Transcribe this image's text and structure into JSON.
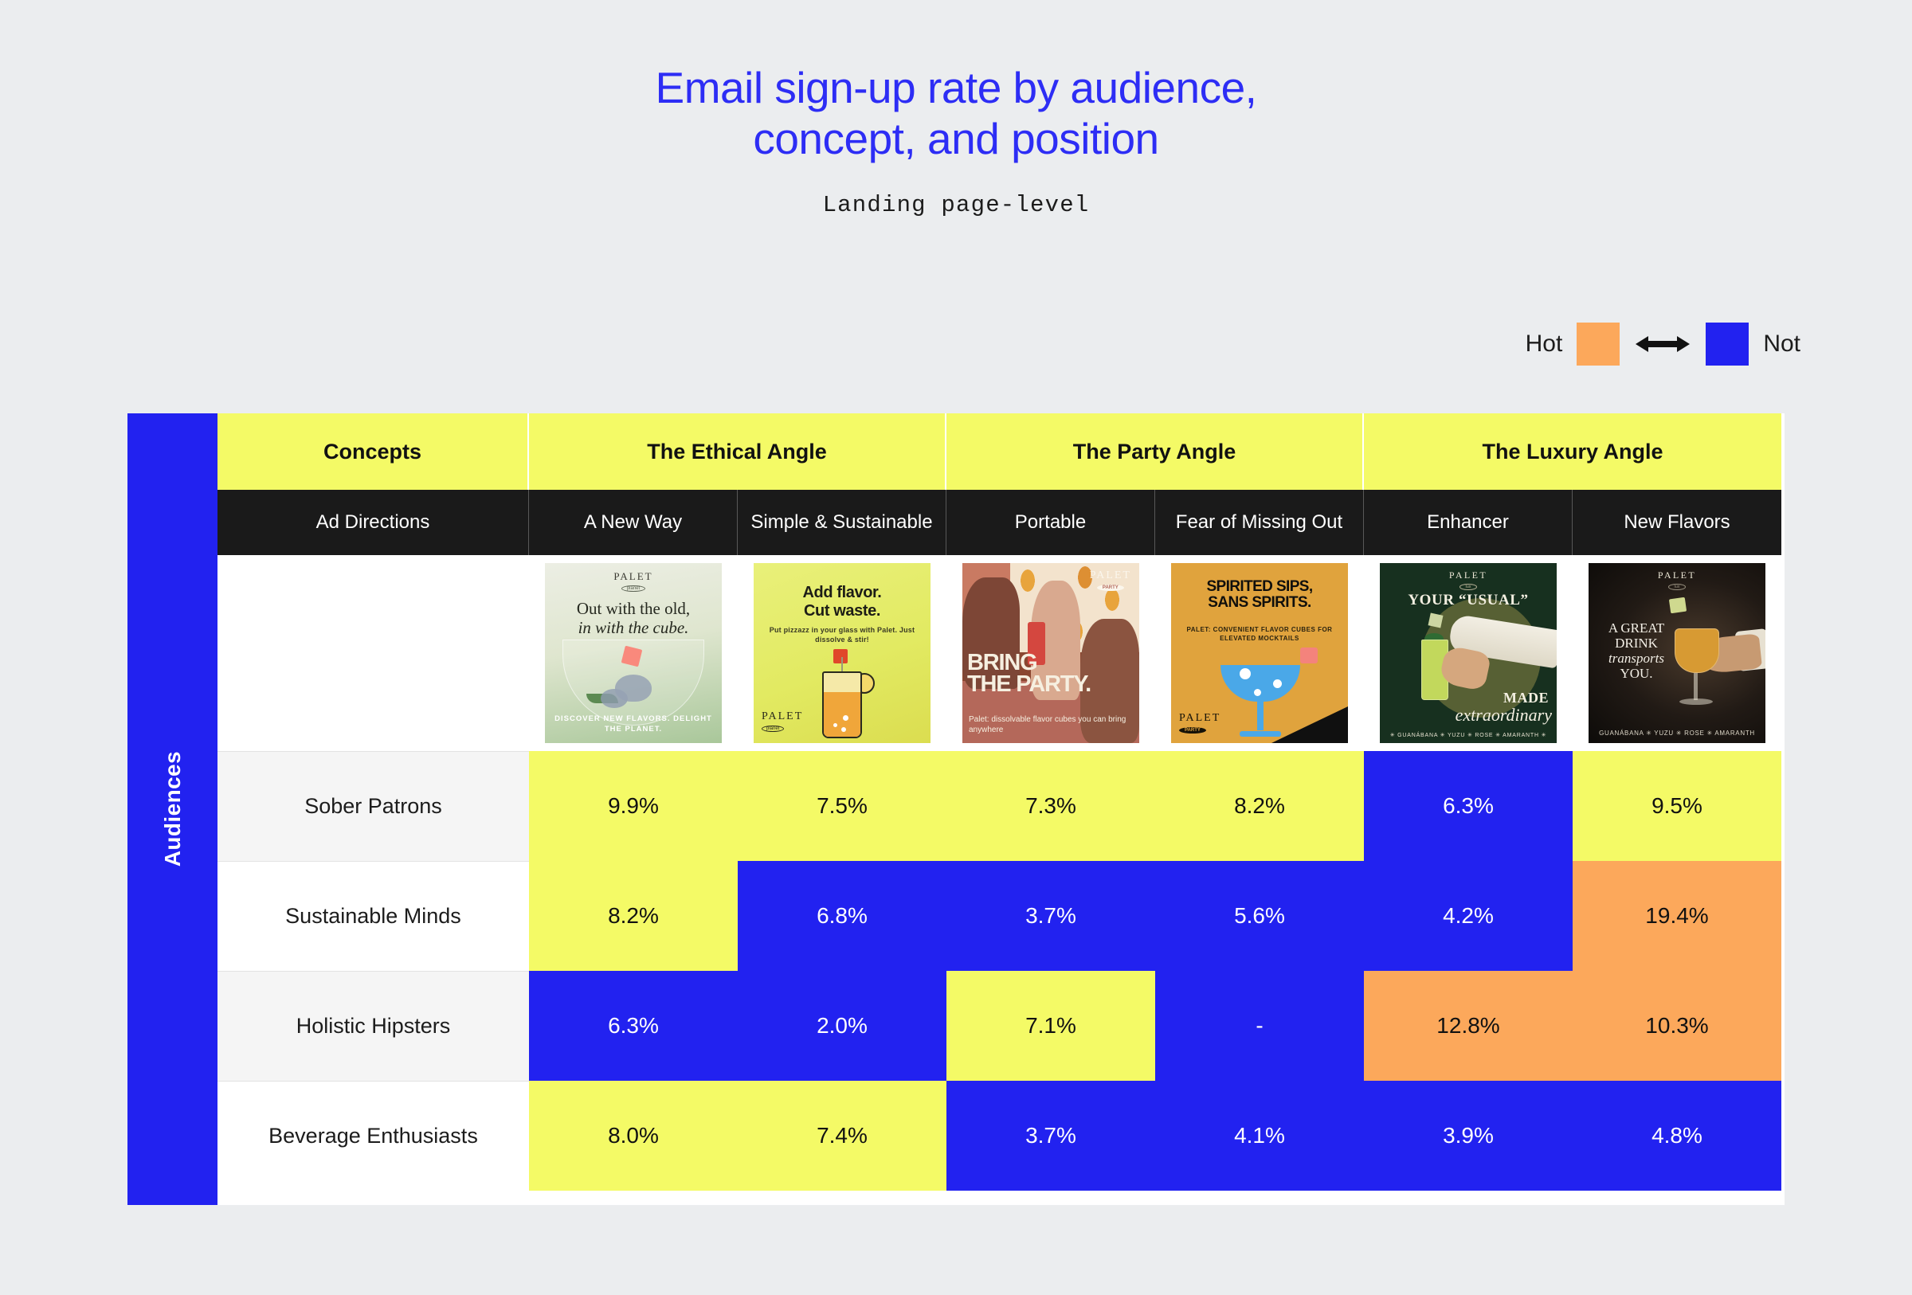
{
  "header": {
    "title_line1": "Email sign-up rate by audience,",
    "title_line2": "concept, and position",
    "subtitle": "Landing page-level",
    "title_color": "#2d2df5"
  },
  "legend": {
    "hot_label": "Hot",
    "not_label": "Not",
    "hot_color": "#fca85b",
    "not_color": "#2222f0"
  },
  "table": {
    "axis_label": "Audiences",
    "concepts_header": "Concepts",
    "ad_directions_header": "Ad Directions",
    "concept_groups": [
      {
        "label": "The Ethical Angle",
        "span": 2
      },
      {
        "label": "The Party Angle",
        "span": 2
      },
      {
        "label": "The Luxury Angle",
        "span": 2
      }
    ],
    "ad_directions": [
      "A New Way",
      "Simple & Sustainable",
      "Portable",
      "Fear of Missing Out",
      "Enhancer",
      "New Flavors"
    ],
    "creatives": [
      {
        "brand": "PALET",
        "sub_brand": "planet",
        "headline": "Out with the old,",
        "headline_italic": "in with the cube.",
        "footer": "DISCOVER NEW FLAVORS. DELIGHT THE PLANET."
      },
      {
        "brand": "PALET",
        "sub_brand": "planet",
        "headline_line1": "Add flavor.",
        "headline_line2": "Cut waste.",
        "body": "Put pizzazz in your glass with Palet. Just dissolve & stir!"
      },
      {
        "brand": "PALET",
        "sub_brand": "PARTY",
        "headline_line1": "BRING",
        "headline_line2": "THE PARTY.",
        "body": "Palet: dissolvable flavor cubes you can bring anywhere"
      },
      {
        "brand": "PALET",
        "sub_brand": "PARTY",
        "headline_line1": "SPIRITED SIPS,",
        "headline_line2": "SANS SPIRITS.",
        "body": "PALET: CONVENIENT FLAVOR CUBES FOR ELEVATED MOCKTAILS"
      },
      {
        "brand": "PALET",
        "sub_brand": "lux",
        "headline_top": "YOUR “USUAL”",
        "headline_mid": "MADE",
        "headline_italic": "extraordinary",
        "footer": "✳ GUANÁBANA ✳ YUZU ✳ ROSE ✳ AMARANTH ✳"
      },
      {
        "brand": "PALET",
        "sub_brand": "lux",
        "headline_line1": "A GREAT",
        "headline_line2": "DRINK",
        "headline_italic": "transports",
        "headline_line3": "YOU.",
        "footer": "GUANÁBANA ✳ YUZU ✳ ROSE ✳ AMARANTH"
      }
    ],
    "audiences": [
      "Sober Patrons",
      "Sustainable Minds",
      "Holistic Hipsters",
      "Beverage Enthusiasts"
    ]
  },
  "chart_data": {
    "type": "heatmap",
    "title": "Email sign-up rate by audience, concept, and position",
    "subtitle": "Landing page-level",
    "xlabel": "Ad Directions",
    "ylabel": "Audiences",
    "categories": [
      "A New Way",
      "Simple & Sustainable",
      "Portable",
      "Fear of Missing Out",
      "Enhancer",
      "New Flavors"
    ],
    "column_groups": [
      "The Ethical Angle",
      "The Ethical Angle",
      "The Party Angle",
      "The Party Angle",
      "The Luxury Angle",
      "The Luxury Angle"
    ],
    "rows": [
      "Sober Patrons",
      "Sustainable Minds",
      "Holistic Hipsters",
      "Beverage Enthusiasts"
    ],
    "values": [
      [
        9.9,
        7.5,
        7.3,
        8.2,
        6.3,
        9.5
      ],
      [
        8.2,
        6.8,
        3.7,
        5.6,
        4.2,
        19.4
      ],
      [
        6.3,
        2.0,
        7.1,
        null,
        12.8,
        10.3
      ],
      [
        8.0,
        7.4,
        3.7,
        4.1,
        3.9,
        4.8
      ]
    ],
    "unit": "%",
    "legend": {
      "position": "top-right",
      "hot": "Hot",
      "not": "Not",
      "hot_color": "#fca85b",
      "not_color": "#2222f0",
      "mid_color": "#f4fa66"
    },
    "cells": [
      [
        {
          "text": "9.9%",
          "tone": "yellow"
        },
        {
          "text": "7.5%",
          "tone": "yellow"
        },
        {
          "text": "7.3%",
          "tone": "yellow"
        },
        {
          "text": "8.2%",
          "tone": "yellow"
        },
        {
          "text": "6.3%",
          "tone": "blue"
        },
        {
          "text": "9.5%",
          "tone": "yellow"
        }
      ],
      [
        {
          "text": "8.2%",
          "tone": "yellow"
        },
        {
          "text": "6.8%",
          "tone": "blue"
        },
        {
          "text": "3.7%",
          "tone": "blue"
        },
        {
          "text": "5.6%",
          "tone": "blue"
        },
        {
          "text": "4.2%",
          "tone": "blue"
        },
        {
          "text": "19.4%",
          "tone": "orange"
        }
      ],
      [
        {
          "text": "6.3%",
          "tone": "blue"
        },
        {
          "text": "2.0%",
          "tone": "blue"
        },
        {
          "text": "7.1%",
          "tone": "yellow"
        },
        {
          "text": "-",
          "tone": "blue"
        },
        {
          "text": "12.8%",
          "tone": "orange"
        },
        {
          "text": "10.3%",
          "tone": "orange"
        }
      ],
      [
        {
          "text": "8.0%",
          "tone": "yellow"
        },
        {
          "text": "7.4%",
          "tone": "yellow"
        },
        {
          "text": "3.7%",
          "tone": "blue"
        },
        {
          "text": "4.1%",
          "tone": "blue"
        },
        {
          "text": "3.9%",
          "tone": "blue"
        },
        {
          "text": "4.8%",
          "tone": "blue"
        }
      ]
    ]
  }
}
